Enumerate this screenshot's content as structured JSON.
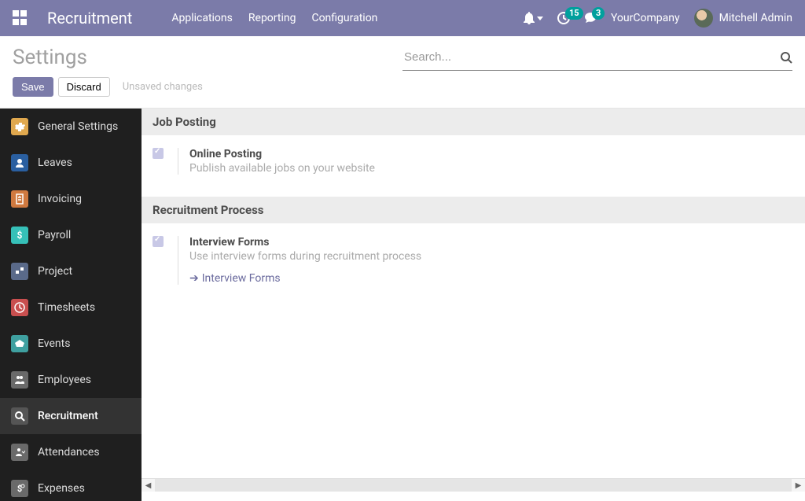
{
  "navbar": {
    "brand": "Recruitment",
    "links": [
      "Applications",
      "Reporting",
      "Configuration"
    ],
    "clock_badge": "15",
    "chat_badge": "3",
    "company": "YourCompany",
    "user": "Mitchell Admin"
  },
  "control": {
    "title": "Settings",
    "save": "Save",
    "discard": "Discard",
    "unsaved": "Unsaved changes",
    "search_placeholder": "Search..."
  },
  "sidebar": {
    "items": [
      {
        "label": "General Settings",
        "color": "#e0a84e"
      },
      {
        "label": "Leaves",
        "color": "#2a5fa0"
      },
      {
        "label": "Invoicing",
        "color": "#d0793f"
      },
      {
        "label": "Payroll",
        "color": "#36c0b8"
      },
      {
        "label": "Project",
        "color": "#5a6a8a"
      },
      {
        "label": "Timesheets",
        "color": "#c94f4f"
      },
      {
        "label": "Events",
        "color": "#3fa0a0"
      },
      {
        "label": "Employees",
        "color": "#6a6a6a"
      },
      {
        "label": "Recruitment",
        "color": "#555"
      },
      {
        "label": "Attendances",
        "color": "#6a6a6a"
      },
      {
        "label": "Expenses",
        "color": "#6a6a6a"
      }
    ],
    "active_index": 8
  },
  "sections": [
    {
      "title": "Job Posting",
      "settings": [
        {
          "checked": true,
          "title": "Online Posting",
          "desc": "Publish available jobs on your website"
        }
      ]
    },
    {
      "title": "Recruitment Process",
      "settings": [
        {
          "checked": true,
          "title": "Interview Forms",
          "desc": "Use interview forms during recruitment process",
          "link": "Interview Forms"
        }
      ]
    }
  ]
}
